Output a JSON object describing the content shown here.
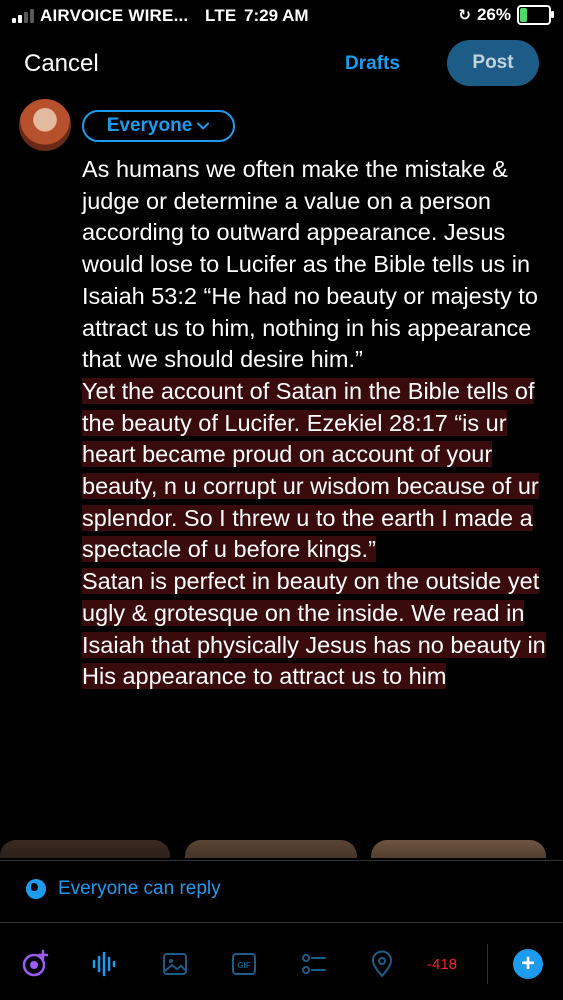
{
  "status_bar": {
    "carrier": "AIRVOICE WIRE...",
    "network": "LTE",
    "time": "7:29 AM",
    "battery_percent": "26%",
    "battery_level": 0.26,
    "signal_bars_active": 2
  },
  "header": {
    "cancel_label": "Cancel",
    "drafts_label": "Drafts",
    "post_label": "Post"
  },
  "composer": {
    "audience_label": "Everyone",
    "paragraphs": [
      "As humans we often make the mistake & judge or determine a value on a person according to outward appearance. Jesus would lose to Lucifer as the Bible tells us in Isaiah 53:2 “He had no beauty or majesty to attract us to him, nothing in his appearance that we should desire him.”",
      "Yet the account of Satan in the Bible tells of the beauty of Lucifer. Ezekiel 28:17 “is ur heart became proud on account of your beauty, n u corrupt ur wisdom because of ur splendor. So I threw u to the earth I made a spectacle of u before kings.”",
      "Satan is perfect in beauty on the outside yet ugly & grotesque on the inside. We read in Isaiah that physically Jesus has no beauty in His appearance to attract us to him"
    ]
  },
  "reply_setting": {
    "label": "Everyone can reply"
  },
  "toolbar": {
    "char_count": "-418"
  },
  "colors": {
    "accent": "#1d9bf0",
    "post_button_disabled": "#1d5c86",
    "highlight_overflow": "#3a0b0d",
    "count_red": "#f4212e",
    "grok_purple": "#9b5cf6"
  }
}
